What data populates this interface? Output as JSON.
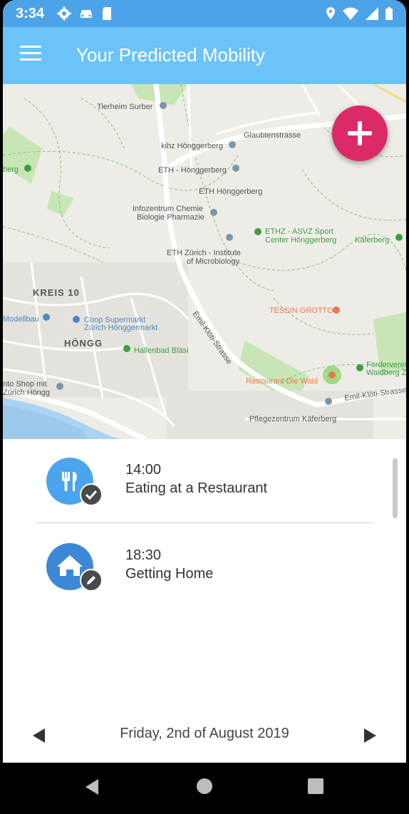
{
  "status_bar": {
    "time": "3:34",
    "left_icons": [
      "gear-icon",
      "car-icon",
      "sd-card-icon"
    ],
    "right_icons": [
      "location-icon",
      "wifi-icon",
      "signal-icon",
      "battery-icon"
    ]
  },
  "app_bar": {
    "title": "Your Predicted Mobility",
    "menu_icon": "hamburger-menu-icon",
    "color": "#6cc3f7"
  },
  "map": {
    "labels": {
      "tierheim": "Tierheim Surber",
      "glaubtenstrasse": "Glaubtenstrasse",
      "kihz": "kihz Hönggerberg",
      "eth_hongg1": "ETH - Hönggerberg",
      "eth_hongg2": "ETH Hönggerberg",
      "infozentrum1": "Infozentrum Chemie",
      "infozentrum2": "Biologie Pharmazie",
      "asvz1": "ETHZ - ASVZ Sport",
      "asvz2": "Center Hönggerberg",
      "kaferberg": "Käferberg",
      "micro1": "ETH Zürich - Institute",
      "micro2": "of Microbiology",
      "kreis10": "KREIS 10",
      "tessin": "TESSIN GROTTO",
      "modellbau": "Modellbau",
      "coop1": "Coop Supermarkt",
      "coop2": "Zürich Hönggermarkt",
      "hongg": "HÖNGG",
      "hallenbad": "Hallenbad Bläsi",
      "emil_kloti1": "Emil-Klöti-Strasse",
      "emil_kloti2": "Emil-Klöti-Strasse",
      "restaurant_waid": "Restaurant Die Waid",
      "forderverein1": "Förderverei",
      "forderverein2": "Waidberg Z",
      "shop1": "nto Shop mit",
      "shop2": "Zürich Höngg",
      "pflegezentrum": "Pflegezentrum Käferberg",
      "berg": "berg"
    }
  },
  "fab": {
    "icon": "plus-icon",
    "color": "#dc2a68"
  },
  "timeline": [
    {
      "time": "14:00",
      "title": "Eating at a Restaurant",
      "icon": "fork-knife-icon",
      "badge": "check-badge-icon"
    },
    {
      "time": "18:30",
      "title": "Getting Home",
      "icon": "home-icon",
      "badge": "pencil-badge-icon"
    }
  ],
  "date_nav": {
    "label": "Friday, 2nd of August 2019",
    "prev_icon": "prev-arrow-icon",
    "next_icon": "next-arrow-icon"
  },
  "system_nav": {
    "icons": [
      "back-icon",
      "home-circle-icon",
      "recents-icon"
    ]
  }
}
